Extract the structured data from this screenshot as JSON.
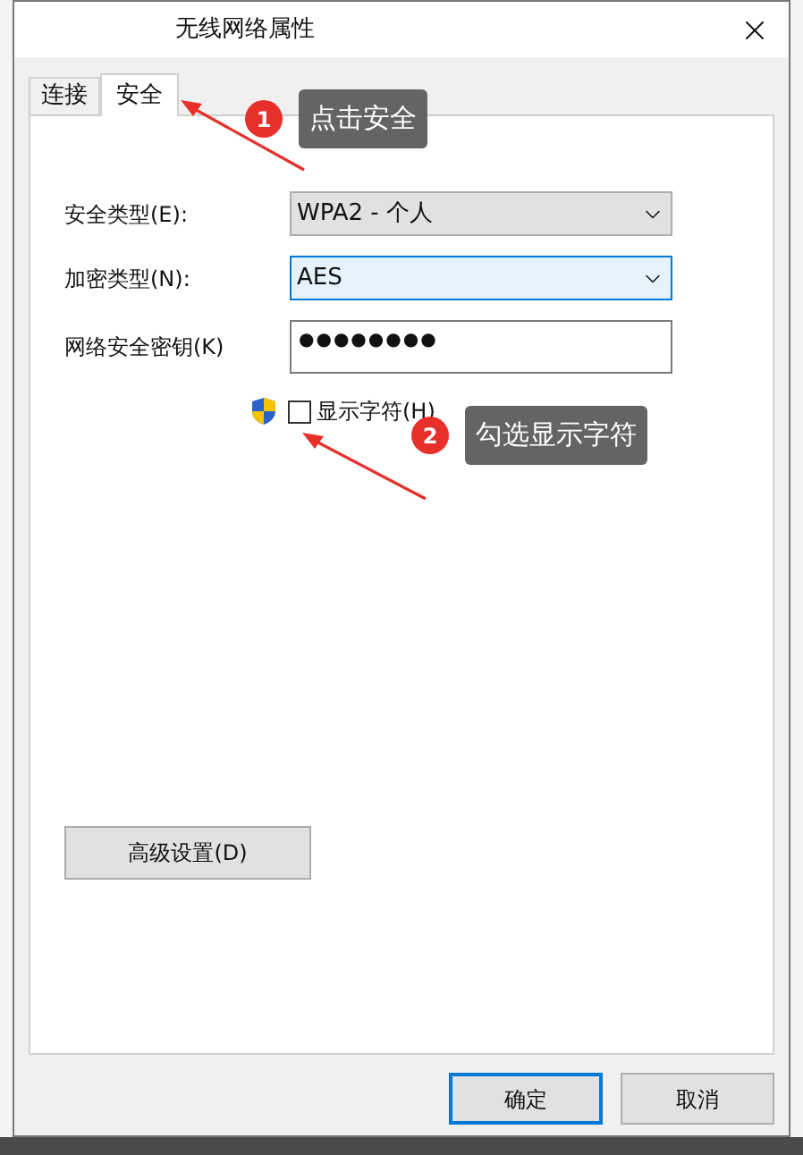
{
  "window": {
    "title": "无线网络属性"
  },
  "tabs": [
    {
      "label": "连接",
      "selected": false
    },
    {
      "label": "安全",
      "selected": true
    }
  ],
  "fields": [
    {
      "kind": "select",
      "label": "安全类型(E):",
      "value": "WPA2 - 个人",
      "focused": false
    },
    {
      "kind": "select",
      "label": "加密类型(N):",
      "value": "AES",
      "focused": true
    },
    {
      "kind": "password",
      "label": "网络安全密钥(K)",
      "value": "●●●●●●●●",
      "focused": false
    }
  ],
  "show_characters": {
    "label": "显示字符(H)",
    "checked": false
  },
  "advanced_button": "高级设置(D)",
  "buttons": [
    {
      "label": "确定",
      "default": true
    },
    {
      "label": "取消",
      "default": false
    }
  ],
  "annotations": [
    {
      "number": "1",
      "text": "点击安全"
    },
    {
      "number": "2",
      "text": "勾选显示字符"
    }
  ]
}
